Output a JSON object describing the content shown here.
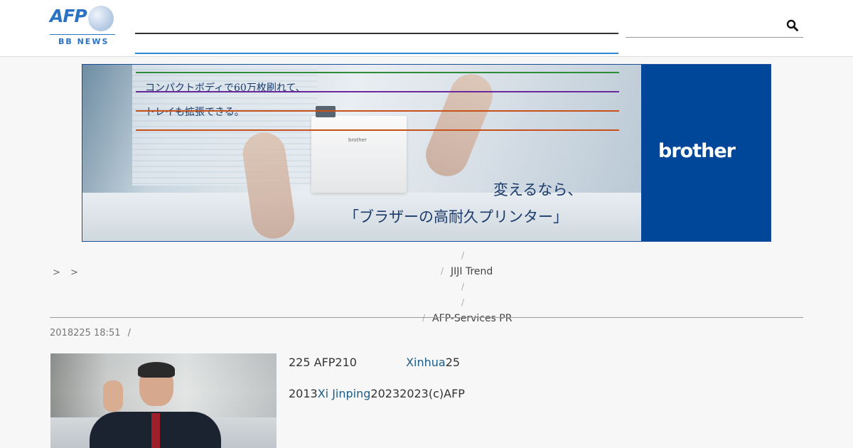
{
  "header": {
    "logo_main": "AFP",
    "logo_sub": "BB NEWS"
  },
  "ad": {
    "copy_line1": "コンパクトボディで60万枚刷れて、",
    "copy_line2": "トレイも拡張できる。",
    "catch_line1": "変えるなら、",
    "catch_line2": "「ブラザーの高耐久プリンター」",
    "brand": "brother",
    "printer_brand": "brother",
    "colors": {
      "panel": "#00479a",
      "line_green": "#2e8b3a",
      "line_purple": "#6a2a9c",
      "line_orange": "#c8501a"
    }
  },
  "breadcrumb": [
    ">",
    ">"
  ],
  "menu": {
    "separators": [
      "/",
      "/",
      "/",
      "/",
      "/",
      "/"
    ],
    "links": [
      "JIJI Trend",
      "AFP-Services PR"
    ]
  },
  "article": {
    "title": "",
    "date": "2018225 18:51",
    "date_sep": "/",
    "p1_text": "225 AFP210",
    "p1_link": "Xinhua",
    "p1_tail": "25",
    "p2_head": "2013",
    "p2_link": "Xi Jinping",
    "p2_tail": "20232023(c)AFP"
  }
}
